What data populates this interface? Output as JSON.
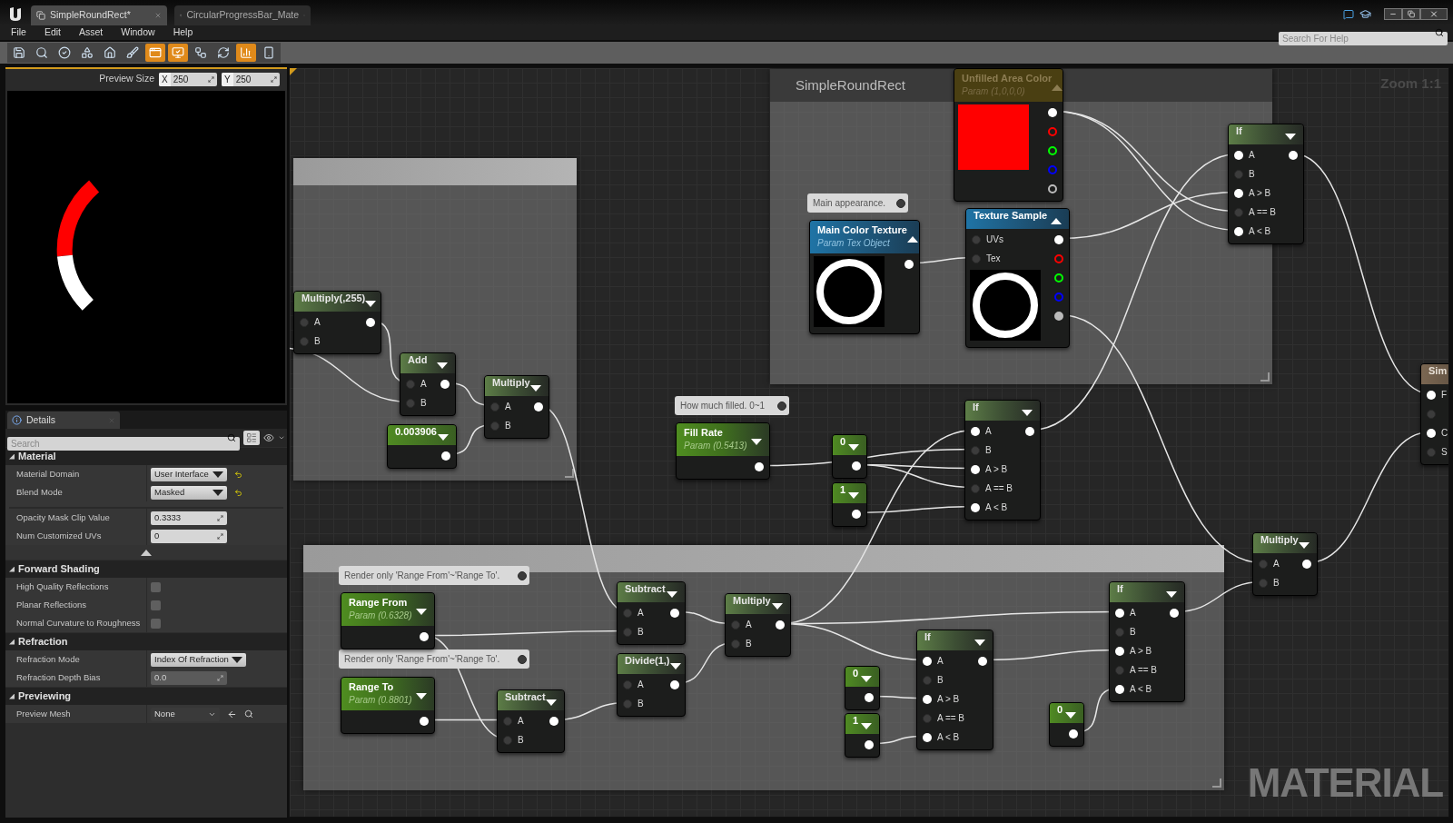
{
  "tabs": [
    {
      "label": "SimpleRoundRect*",
      "selected": true
    },
    {
      "label": "CircularProgressBar_Mate",
      "selected": false
    }
  ],
  "menu": [
    "File",
    "Edit",
    "Asset",
    "Window",
    "Help"
  ],
  "help_search": {
    "placeholder": "Search For Help"
  },
  "toolbar": [
    {
      "active": false
    },
    {
      "active": false
    },
    {
      "active": false
    },
    {
      "active": false
    },
    {
      "active": false
    },
    {
      "active": false
    },
    {
      "active": true
    },
    {
      "active": true
    },
    {
      "active": false
    },
    {
      "active": false
    },
    {
      "active": true
    },
    {
      "active": false
    }
  ],
  "preview": {
    "label": "Preview Size",
    "x_label": "X",
    "x_value": "250",
    "y_label": "Y",
    "y_value": "250"
  },
  "details": {
    "tab": "Details",
    "search": {
      "placeholder": "Search"
    },
    "sections": [
      {
        "title": "Material",
        "expanded": true,
        "rows": [
          {
            "kind": "dropdown",
            "label": "Material Domain",
            "value": "User Interface",
            "reset": true
          },
          {
            "kind": "dropdown",
            "label": "Blend Mode",
            "value": "Masked",
            "reset": true
          },
          {
            "kind": "separator"
          },
          {
            "kind": "number",
            "label": "Opacity Mask Clip Value",
            "value": "0.3333",
            "disabled": false
          },
          {
            "kind": "number",
            "label": "Num Customized UVs",
            "value": "0",
            "disabled": false
          },
          {
            "kind": "more"
          }
        ]
      },
      {
        "title": "Forward Shading",
        "expanded": true,
        "rows": [
          {
            "kind": "checkbox",
            "label": "High Quality Reflections",
            "checked": false
          },
          {
            "kind": "checkbox",
            "label": "Planar Reflections",
            "checked": false
          },
          {
            "kind": "checkbox",
            "label": "Normal Curvature to Roughness",
            "checked": false
          }
        ]
      },
      {
        "title": "Refraction",
        "expanded": true,
        "rows": [
          {
            "kind": "dropdown",
            "label": "Refraction Mode",
            "value": "Index Of Refraction",
            "reset": false
          },
          {
            "kind": "number",
            "label": "Refraction Depth Bias",
            "value": "0.0",
            "disabled": true
          }
        ]
      },
      {
        "title": "Previewing",
        "expanded": true,
        "rows": [
          {
            "kind": "asset",
            "label": "Preview Mesh",
            "value": "None"
          }
        ]
      }
    ]
  },
  "graph": {
    "zoom_label": "Zoom 1:1",
    "watermark": "MATERIAL",
    "comment_boxes": [
      {
        "kind": "plain"
      },
      {
        "kind": "titled",
        "title": "SimpleRoundRect"
      },
      {
        "kind": "plain"
      }
    ],
    "bubbles": [
      "Main appearance.",
      "How much filled. 0~1",
      "Render only 'Range From'~'Range To'.",
      "Render only 'Range From'~'Range To'."
    ],
    "nodes": [
      {
        "kind": "math",
        "title": "Multiply(,255)",
        "preview_expanded": false,
        "inputs": [
          {
            "label": "A",
            "connected": false
          },
          {
            "label": "B",
            "connected": false
          }
        ],
        "outputs": [
          {
            "color": "#ffffff",
            "connected": true
          }
        ]
      },
      {
        "kind": "math",
        "title": "Add",
        "preview_expanded": false,
        "inputs": [
          {
            "label": "A",
            "connected": false
          },
          {
            "label": "B",
            "connected": false
          }
        ],
        "outputs": [
          {
            "color": "#ffffff",
            "connected": true
          }
        ]
      },
      {
        "kind": "constant",
        "title": "0.003906",
        "preview_expanded": false,
        "outputs": [
          {
            "color": "#ffffff",
            "connected": true
          }
        ]
      },
      {
        "kind": "math",
        "title": "Multiply",
        "preview_expanded": false,
        "inputs": [
          {
            "label": "A",
            "connected": false
          },
          {
            "label": "B",
            "connected": false
          }
        ],
        "outputs": [
          {
            "color": "#ffffff",
            "connected": true
          }
        ]
      },
      {
        "kind": "texture",
        "title": "Main Color Texture",
        "subtitle": "Param Tex Object",
        "preview_expanded": true,
        "preview": {
          "kind": "ring"
        },
        "outputs": [
          {
            "color": "#ffffff",
            "connected": true
          }
        ]
      },
      {
        "kind": "vector_param",
        "title": "Unfilled Area Color",
        "subtitle": "Param (1,0,0,0)",
        "preview_expanded": true,
        "preview": {
          "kind": "swatch",
          "color": "#ff0000"
        },
        "outputs": [
          {
            "color": "#ffffff",
            "connected": true
          },
          {
            "color": "#ff0000",
            "connected": false
          },
          {
            "color": "#00ff00",
            "connected": false
          },
          {
            "color": "#0000ff",
            "connected": false
          },
          {
            "color": "#bbbbbb",
            "connected": false
          }
        ]
      },
      {
        "kind": "texture",
        "title": "Texture Sample",
        "preview_expanded": true,
        "preview": {
          "kind": "ring"
        },
        "inputs": [
          {
            "label": "UVs",
            "connected": false
          },
          {
            "label": "Tex",
            "connected": false
          }
        ],
        "outputs": [
          {
            "color": "#ffffff",
            "connected": true
          },
          {
            "color": "#ff0000",
            "connected": false
          },
          {
            "color": "#00ff00",
            "connected": false
          },
          {
            "color": "#0000ff",
            "connected": false
          },
          {
            "color": "#bbbbbb",
            "connected": true
          }
        ]
      },
      {
        "kind": "math",
        "title": "If",
        "preview_expanded": false,
        "inputs": [
          {
            "label": "A",
            "connected": true
          },
          {
            "label": "B",
            "connected": false
          },
          {
            "label": "A > B",
            "connected": true
          },
          {
            "label": "A == B",
            "connected": false
          },
          {
            "label": "A < B",
            "connected": true
          }
        ],
        "outputs": [
          {
            "color": "#ffffff",
            "connected": true
          }
        ]
      },
      {
        "kind": "param",
        "title": "Fill Rate",
        "subtitle": "Param (0.5413)",
        "preview_expanded": false,
        "outputs": [
          {
            "color": "#ffffff",
            "connected": true
          }
        ]
      },
      {
        "kind": "constant",
        "title": "0",
        "preview_expanded": false,
        "outputs": [
          {
            "color": "#ffffff",
            "connected": true
          }
        ]
      },
      {
        "kind": "constant",
        "title": "1",
        "preview_expanded": false,
        "outputs": [
          {
            "color": "#ffffff",
            "connected": true
          }
        ]
      },
      {
        "kind": "math",
        "title": "If",
        "preview_expanded": false,
        "inputs": [
          {
            "label": "A",
            "connected": true
          },
          {
            "label": "B",
            "connected": false
          },
          {
            "label": "A > B",
            "connected": true
          },
          {
            "label": "A == B",
            "connected": false
          },
          {
            "label": "A < B",
            "connected": true
          }
        ],
        "outputs": [
          {
            "color": "#ffffff",
            "connected": true
          }
        ]
      },
      {
        "kind": "math",
        "title": "Multiply",
        "preview_expanded": false,
        "inputs": [
          {
            "label": "A",
            "connected": false
          },
          {
            "label": "B",
            "connected": false
          }
        ],
        "outputs": [
          {
            "color": "#ffffff",
            "connected": true
          }
        ]
      },
      {
        "kind": "function",
        "title": "Sim",
        "preview_expanded": false,
        "inputs": [
          {
            "label": "F",
            "connected": true
          },
          {
            "connected": false
          },
          {
            "label": "C",
            "connected": true
          },
          {
            "label": "S",
            "connected": false
          }
        ]
      },
      {
        "kind": "param",
        "title": "Range From",
        "subtitle": "Param (0.6328)",
        "preview_expanded": false,
        "outputs": [
          {
            "color": "#ffffff",
            "connected": true
          }
        ]
      },
      {
        "kind": "param",
        "title": "Range To",
        "subtitle": "Param (0.8801)",
        "preview_expanded": false,
        "outputs": [
          {
            "color": "#ffffff",
            "connected": true
          }
        ]
      },
      {
        "kind": "math",
        "title": "Subtract",
        "preview_expanded": false,
        "inputs": [
          {
            "label": "A",
            "connected": false
          },
          {
            "label": "B",
            "connected": false
          }
        ],
        "outputs": [
          {
            "color": "#ffffff",
            "connected": true
          }
        ]
      },
      {
        "kind": "math",
        "title": "Multiply",
        "preview_expanded": false,
        "inputs": [
          {
            "label": "A",
            "connected": false
          },
          {
            "label": "B",
            "connected": false
          }
        ],
        "outputs": [
          {
            "color": "#ffffff",
            "connected": true
          }
        ]
      },
      {
        "kind": "math",
        "title": "Divide(1,)",
        "preview_expanded": false,
        "inputs": [
          {
            "label": "A",
            "connected": false
          },
          {
            "label": "B",
            "connected": false
          }
        ],
        "outputs": [
          {
            "color": "#ffffff",
            "connected": true
          }
        ]
      },
      {
        "kind": "math",
        "title": "Subtract",
        "preview_expanded": false,
        "inputs": [
          {
            "label": "A",
            "connected": false
          },
          {
            "label": "B",
            "connected": false
          }
        ],
        "outputs": [
          {
            "color": "#ffffff",
            "connected": true
          }
        ]
      },
      {
        "kind": "constant",
        "title": "0",
        "preview_expanded": false,
        "outputs": [
          {
            "color": "#ffffff",
            "connected": true
          }
        ]
      },
      {
        "kind": "constant",
        "title": "1",
        "preview_expanded": false,
        "outputs": [
          {
            "color": "#ffffff",
            "connected": true
          }
        ]
      },
      {
        "kind": "math",
        "title": "If",
        "preview_expanded": false,
        "inputs": [
          {
            "label": "A",
            "connected": true
          },
          {
            "label": "B",
            "connected": false
          },
          {
            "label": "A > B",
            "connected": true
          },
          {
            "label": "A == B",
            "connected": false
          },
          {
            "label": "A < B",
            "connected": true
          }
        ],
        "outputs": [
          {
            "color": "#ffffff",
            "connected": true
          }
        ]
      },
      {
        "kind": "constant",
        "title": "0",
        "preview_expanded": false,
        "outputs": [
          {
            "color": "#ffffff",
            "connected": true
          }
        ]
      },
      {
        "kind": "math",
        "title": "If",
        "preview_expanded": false,
        "inputs": [
          {
            "label": "A",
            "connected": true
          },
          {
            "label": "B",
            "connected": false
          },
          {
            "label": "A > B",
            "connected": true
          },
          {
            "label": "A == B",
            "connected": false
          },
          {
            "label": "A < B",
            "connected": true
          }
        ],
        "outputs": [
          {
            "color": "#ffffff",
            "connected": true
          }
        ]
      }
    ]
  }
}
